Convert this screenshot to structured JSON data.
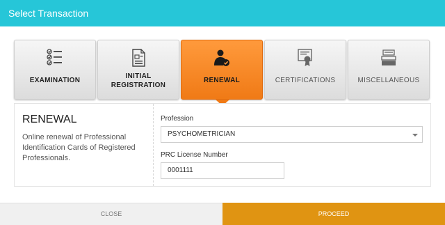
{
  "dialog": {
    "title": "Select Transaction"
  },
  "tiles": [
    {
      "label": "EXAMINATION",
      "icon": "checklist-icon",
      "state": "normal"
    },
    {
      "label_line1": "INITIAL",
      "label_line2": "REGISTRATION",
      "icon": "document-form-icon",
      "state": "normal"
    },
    {
      "label": "RENEWAL",
      "icon": "user-check-icon",
      "state": "active"
    },
    {
      "label": "CERTIFICATIONS",
      "icon": "certificate-icon",
      "state": "dimmed"
    },
    {
      "label": "MISCELLANEOUS",
      "icon": "stack-icon",
      "state": "dimmed"
    }
  ],
  "panel": {
    "title": "RENEWAL",
    "description": "Online renewal of Professional Identification Cards of Registered Professionals.",
    "profession_label": "Profession",
    "profession_value": "PSYCHOMETRICIAN",
    "license_label": "PRC License Number",
    "license_value": "0001111"
  },
  "footer": {
    "close_label": "CLOSE",
    "proceed_label": "PROCEED"
  },
  "colors": {
    "titlebar": "#26c6d8",
    "active_tile": "#f07a16",
    "proceed": "#e09412"
  }
}
